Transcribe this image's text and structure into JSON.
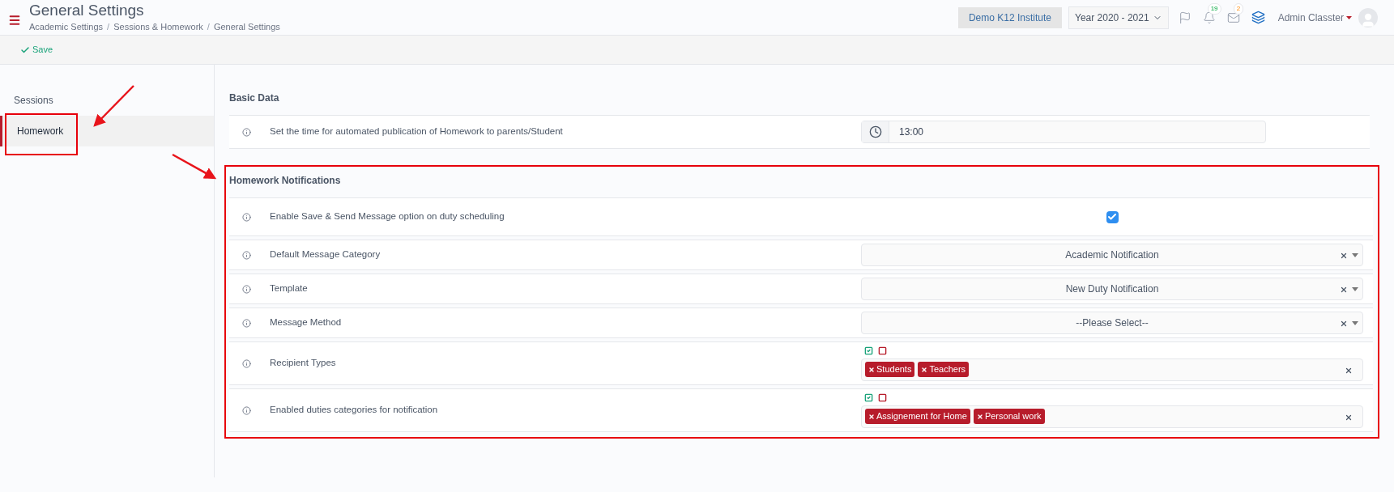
{
  "header": {
    "title": "General Settings",
    "breadcrumbs": [
      "Academic Settings",
      "Sessions & Homework",
      "General Settings"
    ],
    "breadcrumb_separator": "/",
    "institute": "Demo K12 Institute",
    "year": "Year 2020 - 2021",
    "notification_count": "19",
    "message_count": "2",
    "user": "Admin Classter"
  },
  "toolbar": {
    "save": "Save"
  },
  "sidebar": {
    "items": [
      {
        "label": "Sessions",
        "selected": false
      },
      {
        "label": "Homework",
        "selected": true
      }
    ]
  },
  "sections": [
    {
      "title": "Basic Data",
      "highlighted": false,
      "rows": [
        {
          "kind": "time",
          "label": "Set the time for automated publication of Homework to parents/Student",
          "value": "13:00"
        }
      ]
    },
    {
      "title": "Homework Notifications",
      "highlighted": true,
      "rows": [
        {
          "kind": "checkbox",
          "label": "Enable Save & Send Message option on duty scheduling",
          "checked": true
        },
        {
          "kind": "select",
          "label": "Default Message Category",
          "value": "Academic Notification"
        },
        {
          "kind": "select",
          "label": "Template",
          "value": "New Duty Notification"
        },
        {
          "kind": "select",
          "label": "Message Method",
          "value": "--Please Select--"
        },
        {
          "kind": "tags",
          "label": "Recipient Types",
          "tags": [
            "Students",
            "Teachers"
          ]
        },
        {
          "kind": "tags",
          "label": "Enabled duties categories for notification",
          "tags": [
            "Assignement for Home",
            "Personal work"
          ]
        }
      ]
    }
  ]
}
